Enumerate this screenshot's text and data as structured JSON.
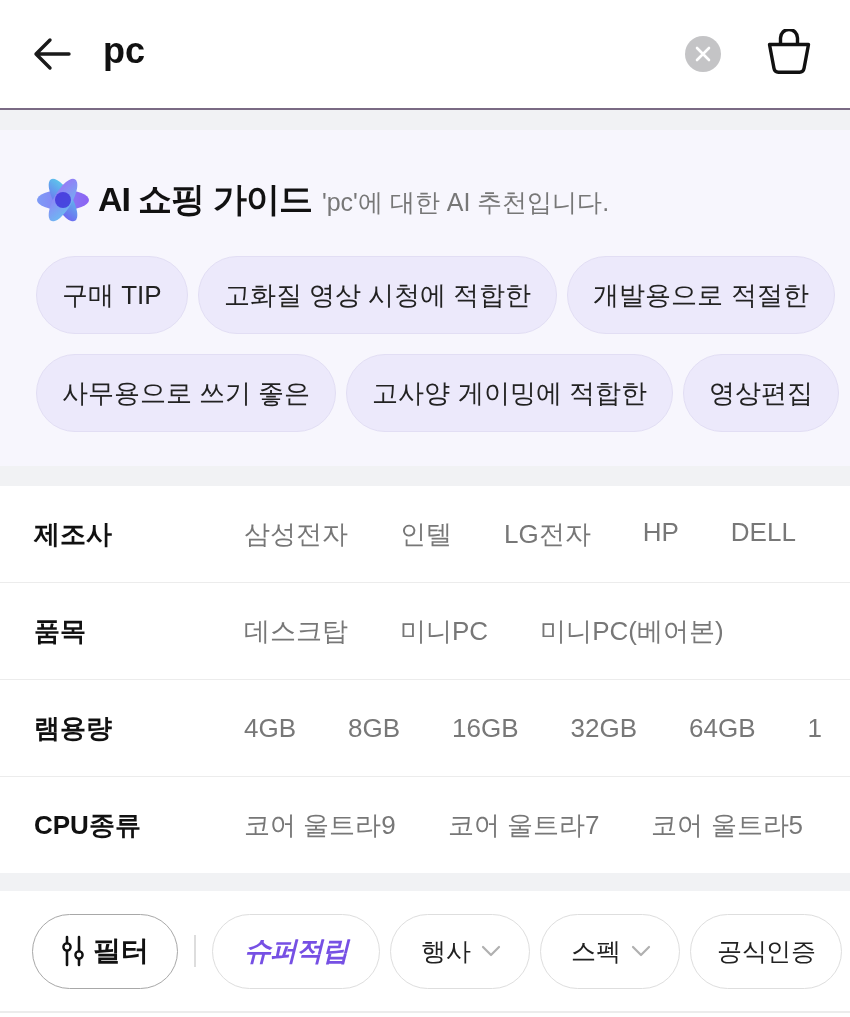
{
  "search": {
    "value": "pc"
  },
  "ai_guide": {
    "title": "AI 쇼핑 가이드",
    "subtitle": "'pc'에 대한 AI 추천입니다.",
    "chip_rows": [
      [
        "구매 TIP",
        "고화질 영상 시청에 적합한",
        "개발용으로 적절한"
      ],
      [
        "사무용으로 쓰기 좋은",
        "고사양 게이밍에 적합한",
        "영상편집"
      ]
    ]
  },
  "filters": [
    {
      "label": "제조사",
      "options": [
        "삼성전자",
        "인텔",
        "LG전자",
        "HP",
        "DELL"
      ]
    },
    {
      "label": "품목",
      "options": [
        "데스크탑",
        "미니PC",
        "미니PC(베어본)"
      ]
    },
    {
      "label": "램용량",
      "options": [
        "4GB",
        "8GB",
        "16GB",
        "32GB",
        "64GB",
        "1"
      ]
    },
    {
      "label": "CPU종류",
      "options": [
        "코어 울트라9",
        "코어 울트라7",
        "코어 울트라5"
      ]
    }
  ],
  "quick_filters": [
    {
      "label": "필터",
      "kind": "filter"
    },
    {
      "label": "슈퍼적립",
      "kind": "promo"
    },
    {
      "label": "행사",
      "kind": "dropdown"
    },
    {
      "label": "스펙",
      "kind": "dropdown"
    },
    {
      "label": "공식인증",
      "kind": "plain"
    }
  ]
}
